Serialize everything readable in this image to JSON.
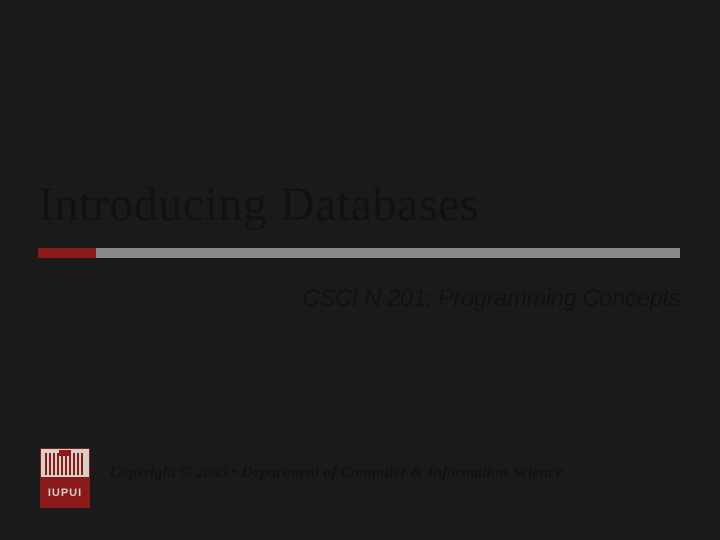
{
  "slide": {
    "title": "Introducing Databases",
    "subtitle": "CSCI N 201: Programming Concepts",
    "copyright": "Copyright © 2005 • Department of Computer & Information Science",
    "logo_text": "IUPUI"
  }
}
